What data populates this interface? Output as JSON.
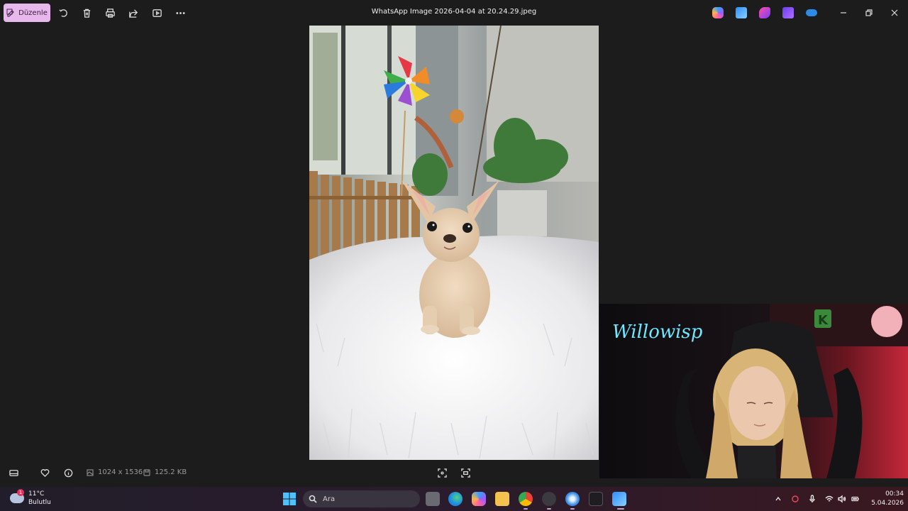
{
  "window": {
    "title": "WhatsApp Image 2026-04-04 at 20.24.29.jpeg",
    "edit_label": "Düzenle"
  },
  "toolbar": {
    "icons": [
      "rotate-icon",
      "delete-icon",
      "print-icon",
      "share-icon",
      "slideshow-icon",
      "more-icon"
    ]
  },
  "titlebar_apps": [
    "copilot-icon",
    "photos-icon",
    "designer-icon",
    "clipchamp-icon",
    "onedrive-icon"
  ],
  "bottombar": {
    "dimensions": "1024 x 1536",
    "file_size": "125.2 KB"
  },
  "webcam": {
    "neon_sign": "Willowisp",
    "badge_letter": "K"
  },
  "taskbar": {
    "weather_temp": "11°C",
    "weather_desc": "Bulutlu",
    "weather_badge": "1",
    "search_placeholder": "Ara",
    "time": "00:34",
    "date": "5.04.2026"
  },
  "colors": {
    "accent": "#e7b8ec",
    "background": "#1c1c1c"
  }
}
